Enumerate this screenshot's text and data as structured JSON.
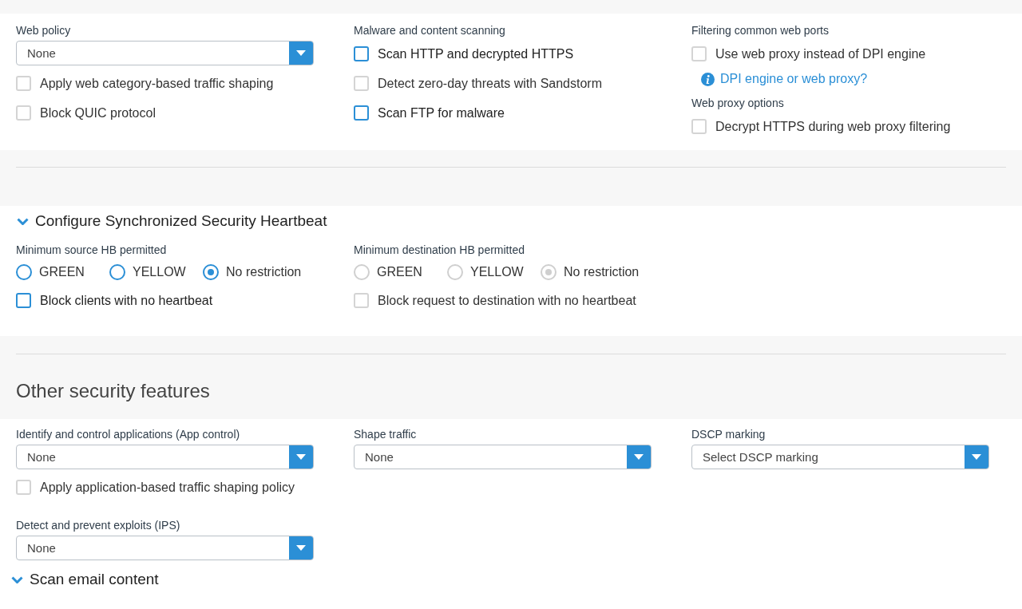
{
  "web_filtering": {
    "columns": [
      {
        "items": [
          {
            "kind": "label",
            "text": "Web policy"
          },
          {
            "kind": "select",
            "value": "None"
          },
          {
            "kind": "checkbox",
            "label": "Apply web category-based traffic shaping",
            "checked": false,
            "disabled": true
          },
          {
            "kind": "checkbox",
            "label": "Block QUIC protocol",
            "checked": false,
            "disabled": true
          }
        ]
      },
      {
        "items": [
          {
            "kind": "label",
            "text": "Malware and content scanning"
          },
          {
            "kind": "checkbox",
            "label": "Scan HTTP and decrypted HTTPS",
            "checked": false,
            "disabled": false
          },
          {
            "kind": "checkbox",
            "label": "Detect zero-day threats with Sandstorm",
            "checked": false,
            "disabled": true
          },
          {
            "kind": "checkbox",
            "label": "Scan FTP for malware",
            "checked": false,
            "disabled": false
          }
        ]
      },
      {
        "items": [
          {
            "kind": "label",
            "text": "Filtering common web ports"
          },
          {
            "kind": "checkbox",
            "label": "Use web proxy instead of DPI engine",
            "checked": false,
            "disabled": true
          },
          {
            "kind": "link",
            "text": "DPI engine or web proxy?"
          },
          {
            "kind": "label",
            "text": "Web proxy options"
          },
          {
            "kind": "checkbox",
            "label": "Decrypt HTTPS during web proxy filtering",
            "checked": false,
            "disabled": true
          }
        ]
      }
    ]
  },
  "heartbeat": {
    "title": "Configure Synchronized Security Heartbeat",
    "expanded": true,
    "columns": [
      {
        "items": [
          {
            "kind": "label",
            "text": "Minimum source HB permitted"
          },
          {
            "kind": "radio_group",
            "disabled": false,
            "options": [
              {
                "label": "GREEN",
                "selected": false
              },
              {
                "label": "YELLOW",
                "selected": false
              },
              {
                "label": "No restriction",
                "selected": true
              }
            ]
          },
          {
            "kind": "checkbox",
            "label": "Block clients with no heartbeat",
            "checked": false,
            "disabled": false
          }
        ]
      },
      {
        "items": [
          {
            "kind": "label",
            "text": "Minimum destination HB permitted"
          },
          {
            "kind": "radio_group",
            "disabled": true,
            "options": [
              {
                "label": "GREEN",
                "selected": false
              },
              {
                "label": "YELLOW",
                "selected": false
              },
              {
                "label": "No restriction",
                "selected": true
              }
            ]
          },
          {
            "kind": "checkbox",
            "label": "Block request to destination with no heartbeat",
            "checked": false,
            "disabled": true
          }
        ]
      }
    ]
  },
  "other_security": {
    "title": "Other security features",
    "columns": [
      {
        "items": [
          {
            "kind": "label",
            "text": "Identify and control applications (App control)"
          },
          {
            "kind": "select",
            "value": "None"
          },
          {
            "kind": "checkbox",
            "label": "Apply application-based traffic shaping policy",
            "checked": false,
            "disabled": true
          },
          {
            "kind": "label",
            "text": "Detect and prevent exploits (IPS)"
          },
          {
            "kind": "select",
            "value": "None"
          }
        ]
      },
      {
        "items": [
          {
            "kind": "label",
            "text": "Shape traffic"
          },
          {
            "kind": "select",
            "value": "None"
          }
        ]
      },
      {
        "items": [
          {
            "kind": "label",
            "text": "DSCP marking"
          },
          {
            "kind": "select",
            "value": "Select DSCP marking"
          }
        ]
      }
    ]
  },
  "scan_email": {
    "title": "Scan email content",
    "expanded": true
  }
}
